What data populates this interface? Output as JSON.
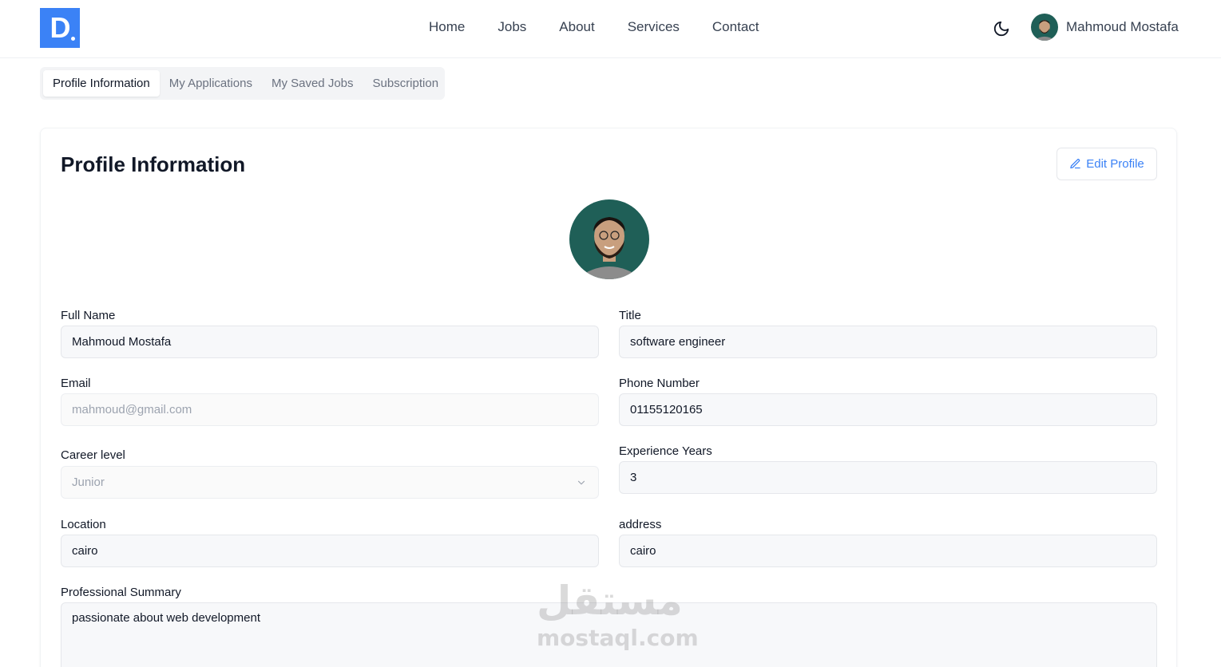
{
  "brand": {
    "logo_letter": "D",
    "accent": "#3b82f6"
  },
  "nav": {
    "items": [
      {
        "label": "Home"
      },
      {
        "label": "Jobs"
      },
      {
        "label": "About"
      },
      {
        "label": "Services"
      },
      {
        "label": "Contact"
      }
    ]
  },
  "header": {
    "theme_icon": "moon-icon",
    "user_name": "Mahmoud Mostafa"
  },
  "tabs": [
    {
      "label": "Profile Information",
      "active": true
    },
    {
      "label": "My Applications",
      "active": false
    },
    {
      "label": "My Saved Jobs",
      "active": false
    },
    {
      "label": "Subscription",
      "active": false
    }
  ],
  "profile": {
    "title": "Profile Information",
    "edit_label": "Edit Profile",
    "fields": {
      "full_name": {
        "label": "Full Name",
        "value": "Mahmoud Mostafa"
      },
      "title": {
        "label": "Title",
        "value": "software engineer"
      },
      "email": {
        "label": "Email",
        "value": "mahmoud@gmail.com"
      },
      "phone": {
        "label": "Phone Number",
        "value": "01155120165"
      },
      "career_level": {
        "label": "Career level",
        "value": "Junior"
      },
      "experience": {
        "label": "Experience Years",
        "value": "3"
      },
      "location": {
        "label": "Location",
        "value": "cairo"
      },
      "address": {
        "label": "address",
        "value": "cairo"
      },
      "summary": {
        "label": "Professional Summary",
        "value": "passionate about web development"
      }
    }
  },
  "watermark": {
    "arabic": "مستقل",
    "latin": "mostaql.com"
  }
}
